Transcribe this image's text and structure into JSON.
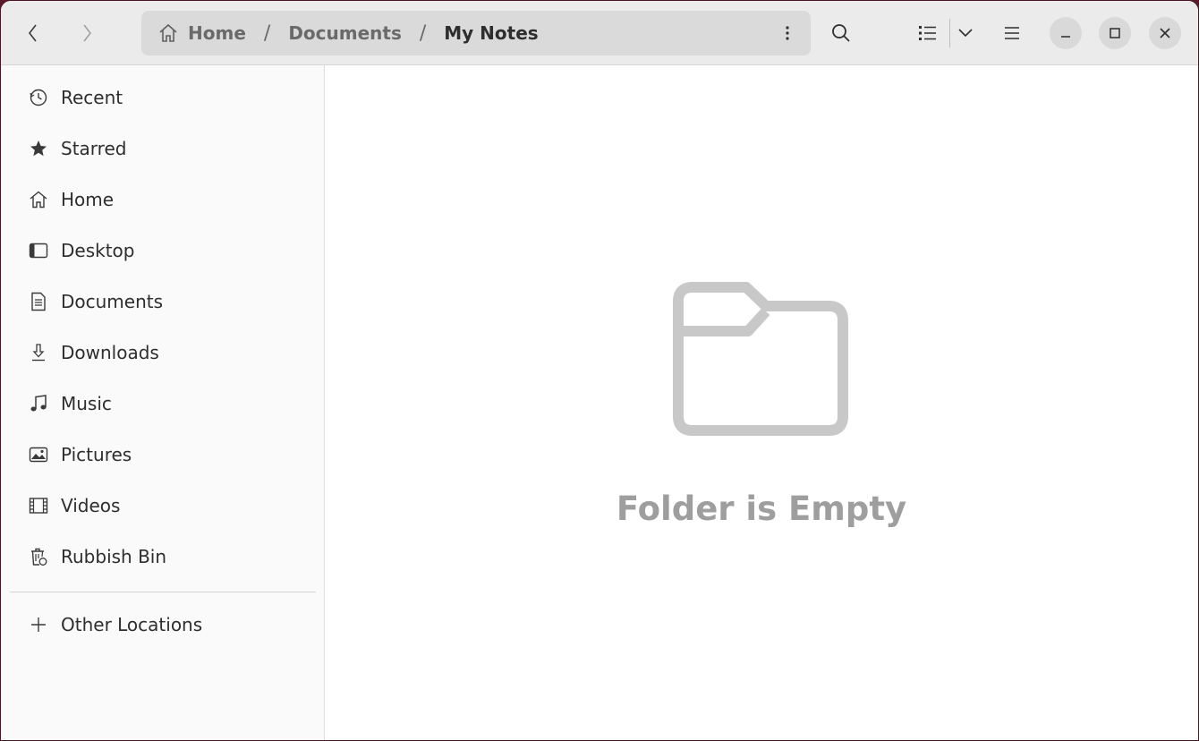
{
  "nav": {
    "back_icon": "chevron-left-icon",
    "forward_icon": "chevron-right-icon"
  },
  "path": {
    "crumbs": [
      "Home",
      "Documents",
      "My Notes"
    ],
    "separator": "/"
  },
  "sidebar": {
    "items": [
      {
        "label": "Recent",
        "icon": "clock-icon"
      },
      {
        "label": "Starred",
        "icon": "star-icon"
      },
      {
        "label": "Home",
        "icon": "home-icon"
      },
      {
        "label": "Desktop",
        "icon": "desktop-icon"
      },
      {
        "label": "Documents",
        "icon": "document-icon"
      },
      {
        "label": "Downloads",
        "icon": "download-icon"
      },
      {
        "label": "Music",
        "icon": "music-icon"
      },
      {
        "label": "Pictures",
        "icon": "picture-icon"
      },
      {
        "label": "Videos",
        "icon": "video-icon"
      },
      {
        "label": "Rubbish Bin",
        "icon": "trash-icon"
      }
    ],
    "other_locations": "Other Locations"
  },
  "content": {
    "empty_message": "Folder is Empty"
  },
  "colors": {
    "accent_text": "#2e2e2e",
    "empty_icon": "#c8c8c8",
    "window_frame": "#5a1a2a"
  }
}
